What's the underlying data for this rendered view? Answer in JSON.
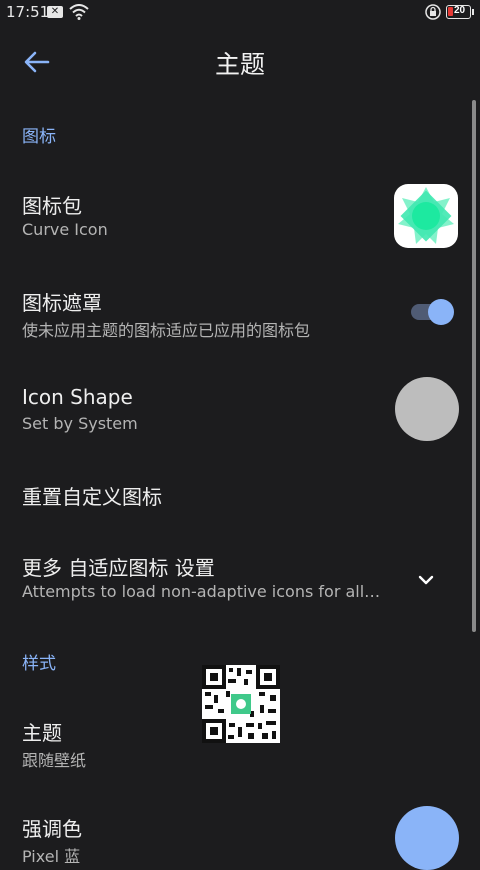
{
  "status_bar": {
    "time": "17:51",
    "battery_level": "20",
    "icons": [
      "notification-x-icon",
      "wifi-icon",
      "lock-icon",
      "battery-icon"
    ]
  },
  "toolbar": {
    "title": "主题",
    "back_icon": "arrow-left-icon"
  },
  "sections": {
    "icons_header": "图标",
    "style_header": "样式"
  },
  "items": {
    "icon_pack": {
      "title": "图标包",
      "summary": "Curve Icon"
    },
    "icon_mask": {
      "title": "图标遮罩",
      "summary": "使未应用主题的图标适应已应用的图标包",
      "enabled": true
    },
    "icon_shape": {
      "title": "Icon Shape",
      "summary": "Set by System"
    },
    "reset_icons": {
      "title": "重置自定义图标"
    },
    "adaptive_more": {
      "title": "更多 自适应图标 设置",
      "summary": "Attempts to load non-adaptive icons for all…"
    },
    "theme": {
      "title": "主题",
      "summary": "跟随壁纸"
    },
    "accent": {
      "title": "强调色",
      "summary": "Pixel 蓝"
    }
  },
  "colors": {
    "background": "#1c1c1e",
    "accent": "#8ab4f8",
    "icon_pack_green": "#1de9a0",
    "shape_gray": "#bdbdbd"
  }
}
